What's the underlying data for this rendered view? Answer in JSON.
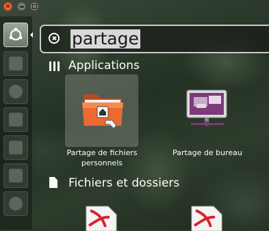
{
  "window_controls": {
    "close": "×",
    "minimize": "",
    "maximize": ""
  },
  "search": {
    "query": "partage"
  },
  "sections": {
    "applications": {
      "title": "Applications"
    },
    "files": {
      "title": "Fichiers et dossiers"
    }
  },
  "apps": [
    {
      "label": "Partage de fichiers personnels",
      "icon": "shared-folder-icon",
      "selected": true
    },
    {
      "label": "Partage de bureau",
      "icon": "desktop-sharing-icon",
      "selected": false
    }
  ],
  "files": [
    {
      "icon": "pdf-file-icon"
    },
    {
      "icon": "pdf-file-icon"
    }
  ],
  "launcher_items": [
    "ubuntu-logo-icon",
    "files-icon",
    "firefox-icon",
    "software-icon",
    "writer-icon",
    "calc-icon",
    "settings-icon"
  ],
  "colors": {
    "accent_orange": "#e8673a",
    "purple": "#7b3a7a",
    "pdf_red": "#d6252b"
  }
}
